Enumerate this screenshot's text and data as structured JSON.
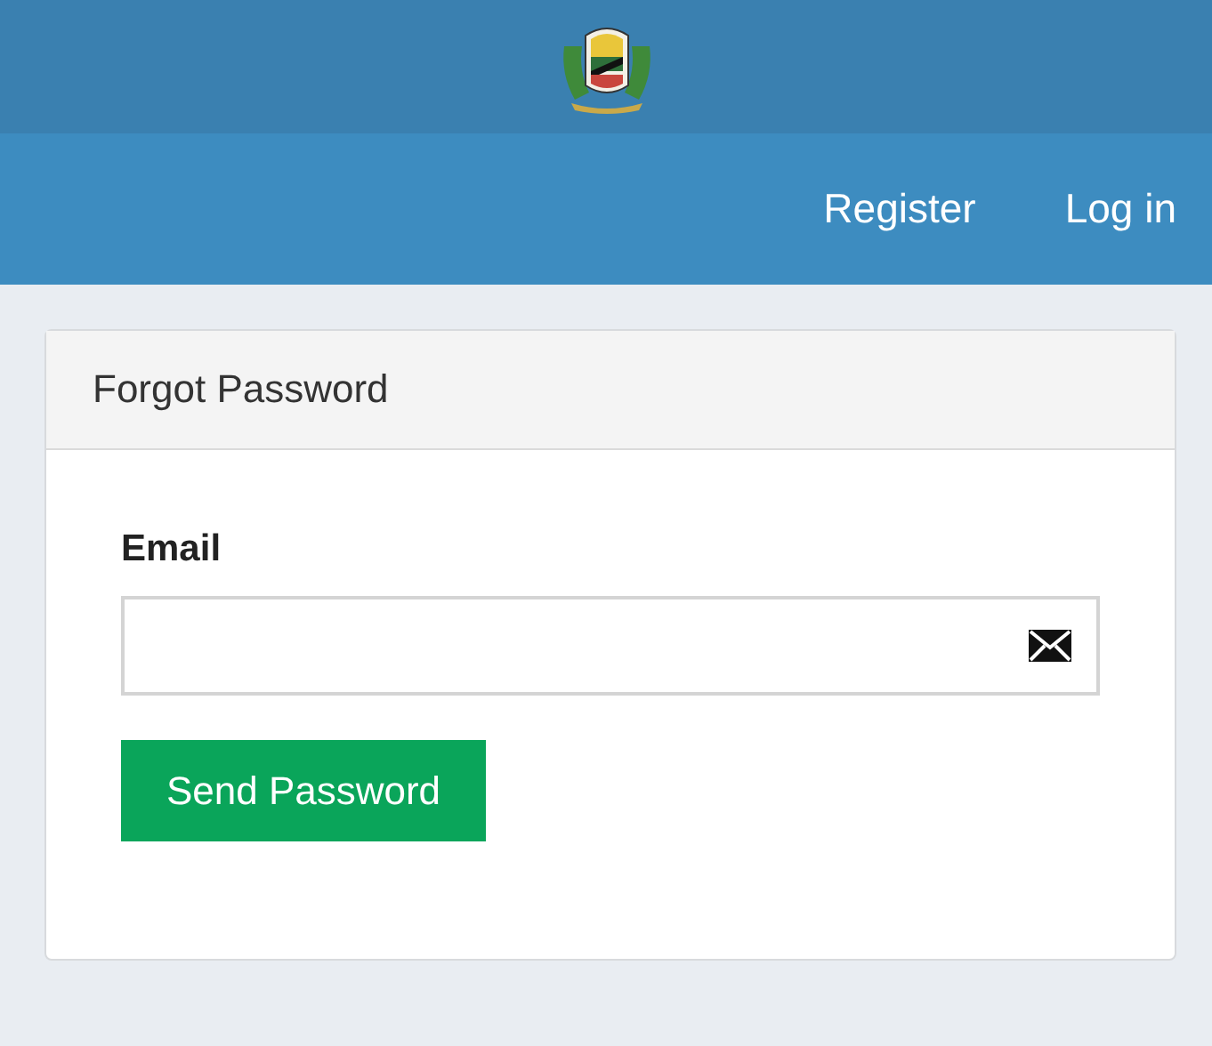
{
  "nav": {
    "links": [
      {
        "label": "Register"
      },
      {
        "label": "Log in"
      }
    ]
  },
  "panel": {
    "title": "Forgot Password",
    "field": {
      "label": "Email"
    },
    "button": "Send Password"
  }
}
